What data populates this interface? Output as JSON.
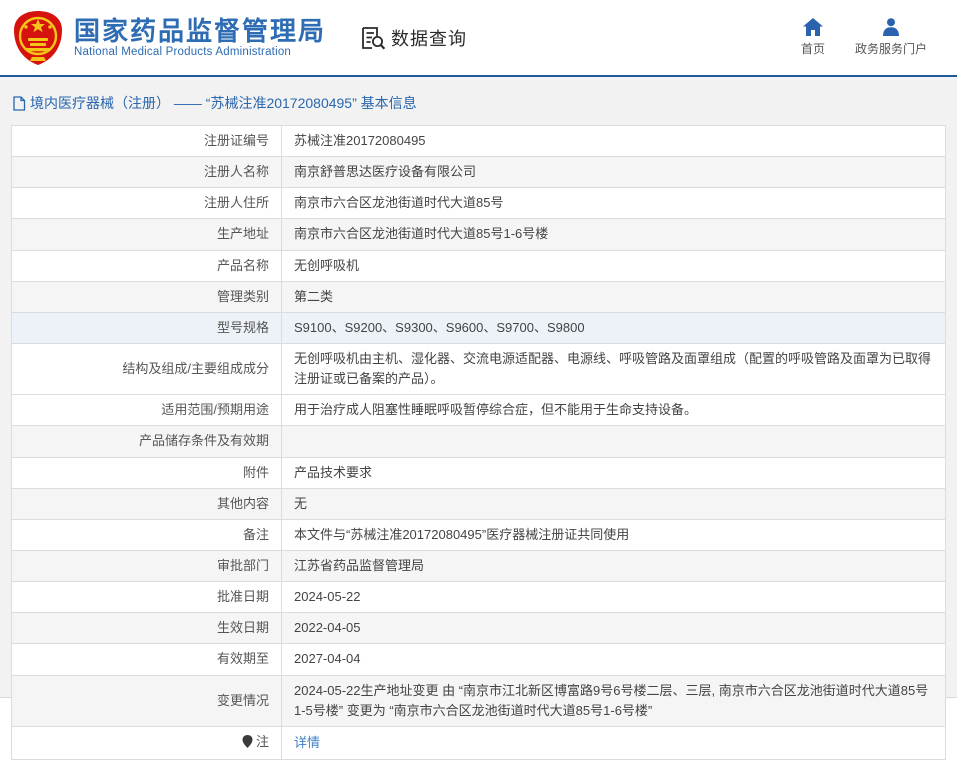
{
  "header": {
    "logo": {
      "title": "国家药品监督管理局",
      "subtitle": "National Medical Products Administration",
      "emblem_icon": "national-emblem-icon"
    },
    "data_query": {
      "label": "数据查询",
      "icon": "document-search-icon"
    },
    "nav": [
      {
        "label": "首页",
        "icon": "home-icon"
      },
      {
        "label": "政务服务门户",
        "icon": "user-icon"
      }
    ]
  },
  "breadcrumb": {
    "icon": "document-icon",
    "text": "境内医疗器械（注册） —— “苏械注准20172080495” 基本信息"
  },
  "table": {
    "rows": [
      {
        "label": "注册证编号",
        "value": "苏械注准20172080495",
        "bg": "white"
      },
      {
        "label": "注册人名称",
        "value": "南京舒普思达医疗设备有限公司",
        "bg": "gray"
      },
      {
        "label": "注册人住所",
        "value": "南京市六合区龙池街道时代大道85号",
        "bg": "white"
      },
      {
        "label": "生产地址",
        "value": "南京市六合区龙池街道时代大道85号1-6号楼",
        "bg": "gray"
      },
      {
        "label": "产品名称",
        "value": "无创呼吸机",
        "bg": "white"
      },
      {
        "label": "管理类别",
        "value": "第二类",
        "bg": "gray"
      },
      {
        "label": "型号规格",
        "value": "S9100、S9200、S9300、S9600、S9700、S9800",
        "bg": "blue"
      },
      {
        "label": "结构及组成/主要组成成分",
        "value": "无创呼吸机由主机、湿化器、交流电源适配器、电源线、呼吸管路及面罩组成（配置的呼吸管路及面罩为已取得注册证或已备案的产品）。",
        "bg": "white"
      },
      {
        "label": "适用范围/预期用途",
        "value": "用于治疗成人阻塞性睡眠呼吸暂停综合症，但不能用于生命支持设备。",
        "bg": "white"
      },
      {
        "label": "产品储存条件及有效期",
        "value": "",
        "bg": "gray"
      },
      {
        "label": "附件",
        "value": "产品技术要求",
        "bg": "white"
      },
      {
        "label": "其他内容",
        "value": "无",
        "bg": "gray"
      },
      {
        "label": "备注",
        "value": "本文件与“苏械注准20172080495”医疗器械注册证共同使用",
        "bg": "white"
      },
      {
        "label": "审批部门",
        "value": "江苏省药品监督管理局",
        "bg": "gray"
      },
      {
        "label": "批准日期",
        "value": "2024-05-22",
        "bg": "white"
      },
      {
        "label": "生效日期",
        "value": "2022-04-05",
        "bg": "gray"
      },
      {
        "label": "有效期至",
        "value": "2027-04-04",
        "bg": "white"
      },
      {
        "label": "变更情况",
        "value": "2024-05-22生产地址变更 由 “南京市江北新区博富路9号6号楼二层、三层, 南京市六合区龙池街道时代大道85号1-5号楼” 变更为 “南京市六合区龙池街道时代大道85号1-6号楼”",
        "bg": "gray"
      },
      {
        "label": "注",
        "label_icon": "pin-icon",
        "value": "详情",
        "link": true,
        "bg": "white"
      }
    ]
  },
  "colors": {
    "accent_blue": "#2e6cb3",
    "header_line": "#1e5a99",
    "link_blue": "#3f80c6",
    "row_gray": "#f5f5f5",
    "row_highlight": "#edf1f8"
  }
}
